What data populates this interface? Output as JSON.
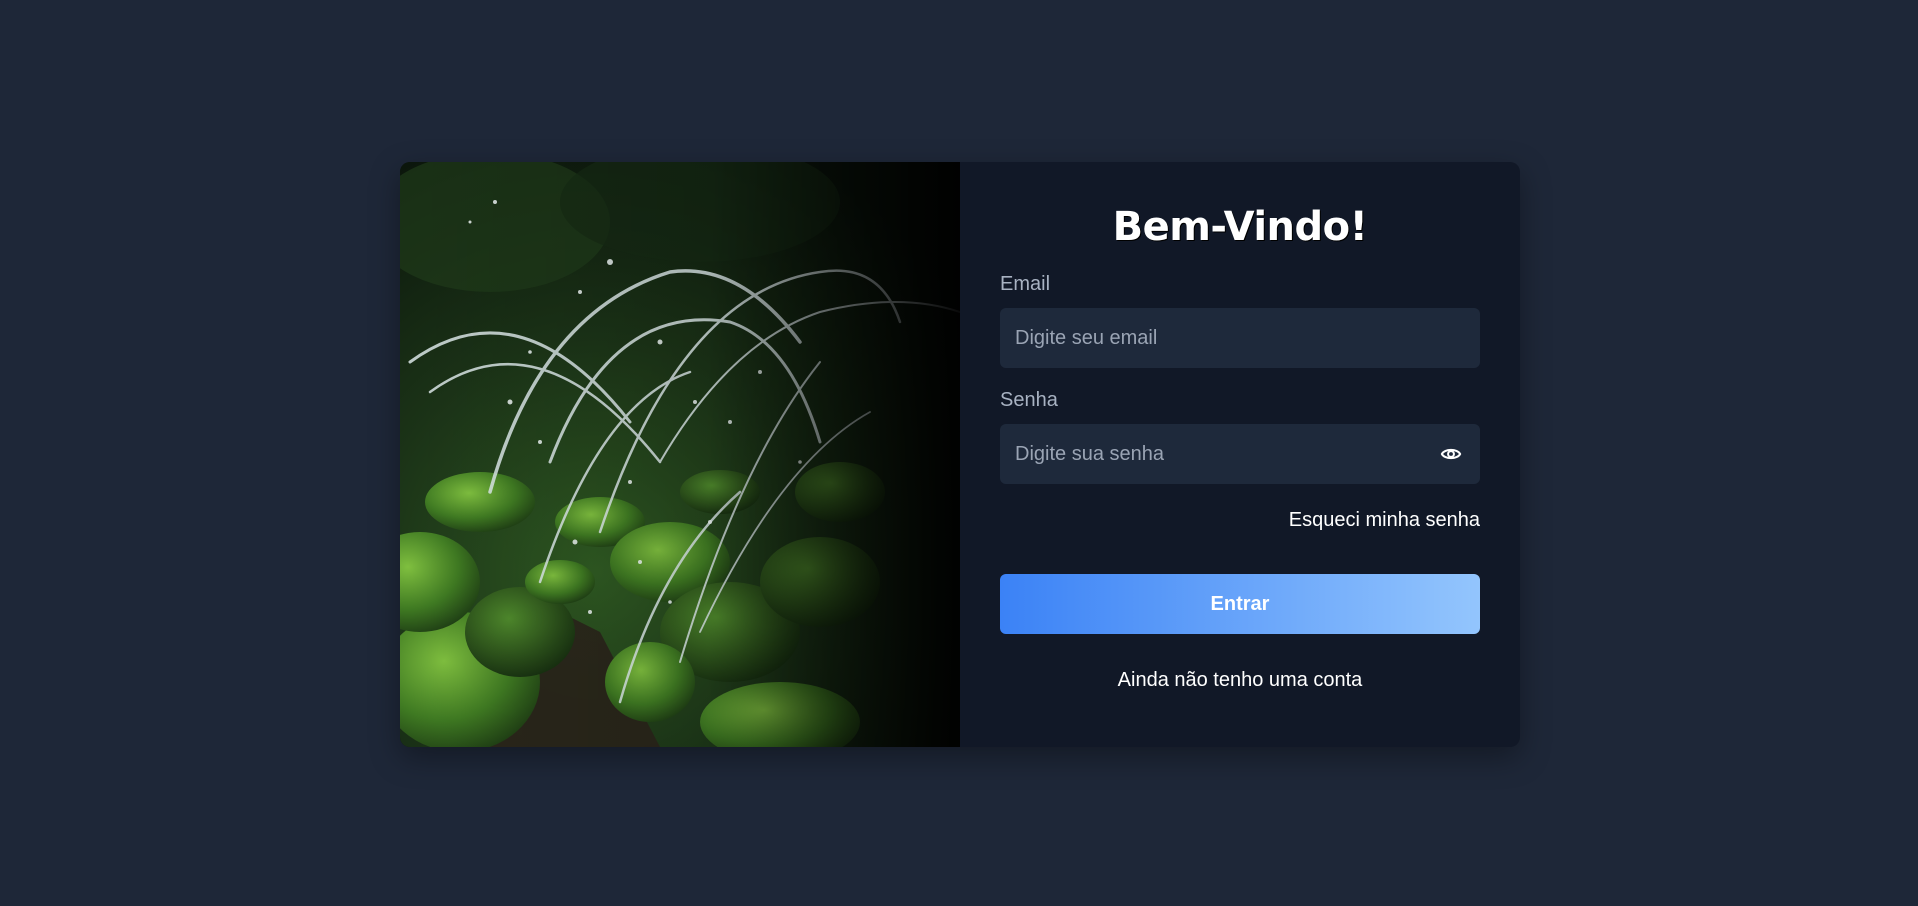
{
  "login": {
    "title": "Bem-Vindo!",
    "email_label": "Email",
    "email_placeholder": "Digite seu email",
    "email_value": "",
    "password_label": "Senha",
    "password_placeholder": "Digite sua senha",
    "password_value": "",
    "password_toggle_icon": "eye-icon",
    "forgot_link": "Esqueci minha senha",
    "submit_label": "Entrar",
    "signup_link": "Ainda não tenho uma conta"
  },
  "colors": {
    "page_background": "#1e2738",
    "card_background": "#111827",
    "input_background": "#1e293b",
    "button_gradient_start": "#3b82f6",
    "button_gradient_end": "#93c5fd"
  }
}
